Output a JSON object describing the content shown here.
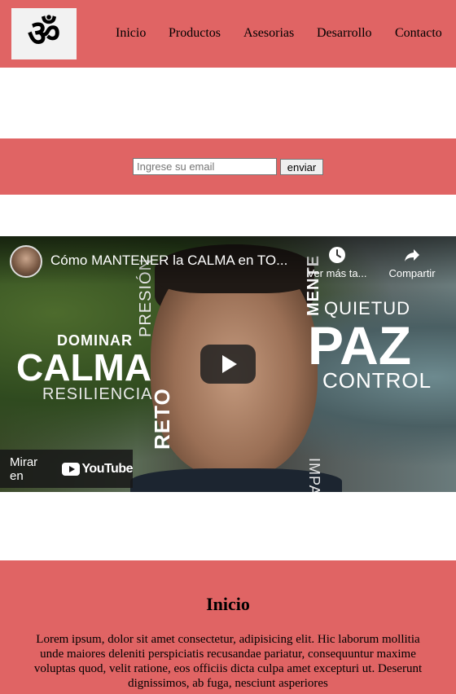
{
  "header": {
    "logo_icon": "om-symbol-icon",
    "logo_glyph": "ॐ",
    "nav": [
      "Inicio",
      "Productos",
      "Asesorias",
      "Desarrollo",
      "Contacto"
    ]
  },
  "subscribe": {
    "email_placeholder": "Ingrese su email",
    "email_value": "",
    "send_label": "enviar"
  },
  "video": {
    "title": "Cómo MANTENER la CALMA en TO...",
    "watch_later_label": "Ver más ta...",
    "share_label": "Compartir",
    "watch_on_label": "Mirar en",
    "youtube_wordmark": "YouTube",
    "thumbnail_words": {
      "dominar": "DOMINAR",
      "calma": "CALMA",
      "resiliencia": "RESILIENCIA",
      "presion": "PRESIÓN",
      "reto": "RETO",
      "mente": "MENTE",
      "quietud": "QUIETUD",
      "paz": "PAZ",
      "control": "CONTROL",
      "impasible": "IMPASIBLE"
    }
  },
  "content": {
    "heading": "Inicio",
    "body": "Lorem ipsum, dolor sit amet consectetur, adipisicing elit. Hic laborum mollitia unde maiores deleniti perspiciatis recusandae pariatur, consequuntur maxime voluptas quod, velit ratione, eos officiis dicta culpa amet excepturi ut. Deserunt dignissimos, ab fuga, nesciunt asperiores"
  },
  "colors": {
    "brand_red": "#e06464",
    "white": "#ffffff"
  }
}
